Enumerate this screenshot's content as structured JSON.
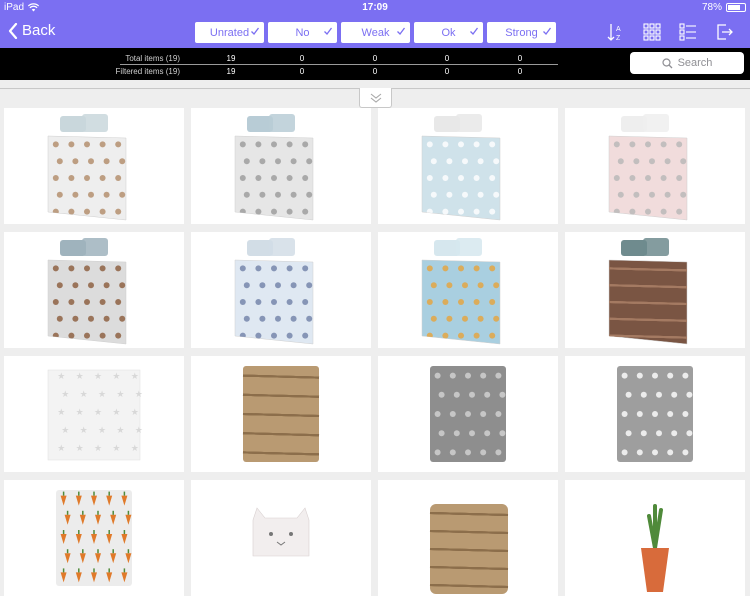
{
  "status": {
    "device": "iPad",
    "time": "17:09",
    "battery": "78%",
    "battery_level": 0.78
  },
  "nav": {
    "back_label": "Back",
    "filters": [
      {
        "label": "Unrated"
      },
      {
        "label": "No"
      },
      {
        "label": "Weak"
      },
      {
        "label": "Ok"
      },
      {
        "label": "Strong"
      }
    ],
    "icons": [
      "sort-az-icon",
      "grid-view-icon",
      "list-view-icon",
      "export-icon"
    ]
  },
  "stats": {
    "rows": [
      {
        "label": "Total items (19)",
        "values": [
          "19",
          "0",
          "0",
          "0",
          "0"
        ]
      },
      {
        "label": "Filtered items (19)",
        "values": [
          "19",
          "0",
          "0",
          "0",
          "0"
        ]
      }
    ],
    "search_label": "Search"
  },
  "colors": {
    "accent": "#7b6ff2",
    "stats_bg": "#000000"
  },
  "products": [
    {
      "type": "duvet",
      "pattern": "rabbits",
      "base": "#eeeeee",
      "accent": "#b08a66",
      "pillow": "#c9d7dc"
    },
    {
      "type": "duvet",
      "pattern": "speckle",
      "base": "#e6e6e6",
      "accent": "#9a9a9a",
      "pillow": "#b8ccd6"
    },
    {
      "type": "duvet",
      "pattern": "bear",
      "base": "#cfe2ea",
      "accent": "#ffffff",
      "pillow": "#e8e8e8"
    },
    {
      "type": "duvet",
      "pattern": "cats",
      "base": "#f1dcdc",
      "accent": "#b6b6b6",
      "pillow": "#eeeeee"
    },
    {
      "type": "duvet",
      "pattern": "horses",
      "base": "#dcdcdc",
      "accent": "#8a5a3a",
      "pillow": "#9fb3bd"
    },
    {
      "type": "duvet",
      "pattern": "dots",
      "base": "#dfe8f2",
      "accent": "#6f7fa6",
      "pillow": "#d2dde6"
    },
    {
      "type": "duvet",
      "pattern": "food",
      "base": "#a9cfe0",
      "accent": "#e7a23a",
      "pillow": "#d6e7ee"
    },
    {
      "type": "duvet",
      "pattern": "wood",
      "base": "#7a5543",
      "accent": "#a47a62",
      "pillow": "#6f8b8e"
    },
    {
      "type": "sheet",
      "pattern": "stars",
      "base": "#f3f3f3",
      "accent": "#d8d8d8"
    },
    {
      "type": "blanket",
      "pattern": "straw",
      "base": "#b99a72",
      "accent": "#8c6e4b"
    },
    {
      "type": "blanket",
      "pattern": "owls",
      "base": "#8e8e8e",
      "accent": "#d4d4d4"
    },
    {
      "type": "blanket",
      "pattern": "cats",
      "base": "#9e9e9e",
      "accent": "#ffffff"
    },
    {
      "type": "blanket",
      "pattern": "carrots",
      "base": "#ececec",
      "accent": "#e07a2a"
    },
    {
      "type": "cushion",
      "pattern": "catface",
      "base": "#f2eeee",
      "accent": "#777777"
    },
    {
      "type": "cushion",
      "pattern": "straw",
      "base": "#b99a72",
      "accent": "#8c6e4b"
    },
    {
      "type": "plant",
      "pattern": "pot",
      "base": "#d86b3b",
      "accent": "#4f8a3a"
    }
  ]
}
